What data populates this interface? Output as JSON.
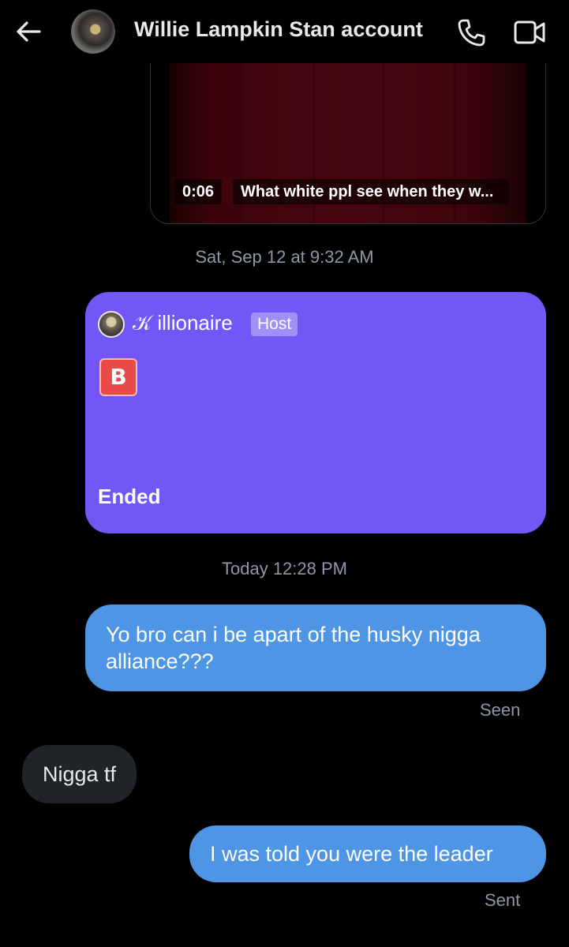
{
  "header": {
    "title": "Willie Lampkin Stan account",
    "icons": [
      "back-arrow-icon",
      "phone-icon",
      "video-camera-icon"
    ]
  },
  "video_message": {
    "duration": "0:06",
    "caption": "What white ppl see when they w..."
  },
  "timestamps": {
    "first": "Sat, Sep 12 at 9:32 AM",
    "second": "Today 12:28 PM"
  },
  "space_card": {
    "host_name": "𝒦 illionaire",
    "host_badge": "Host",
    "emoji": "B",
    "status": "Ended",
    "color": "#7356f6"
  },
  "messages": [
    {
      "direction": "sent",
      "text": "Yo bro can i be apart of the husky nigga alliance???",
      "status": "Seen"
    },
    {
      "direction": "received",
      "text": "Nigga tf"
    },
    {
      "direction": "sent",
      "text": "I was told you were the leader",
      "status": "Sent"
    }
  ],
  "colors": {
    "sent_bubble": "#4f95e6",
    "received_bubble": "#202327",
    "background": "#000000",
    "muted_text": "#8b98a5"
  }
}
